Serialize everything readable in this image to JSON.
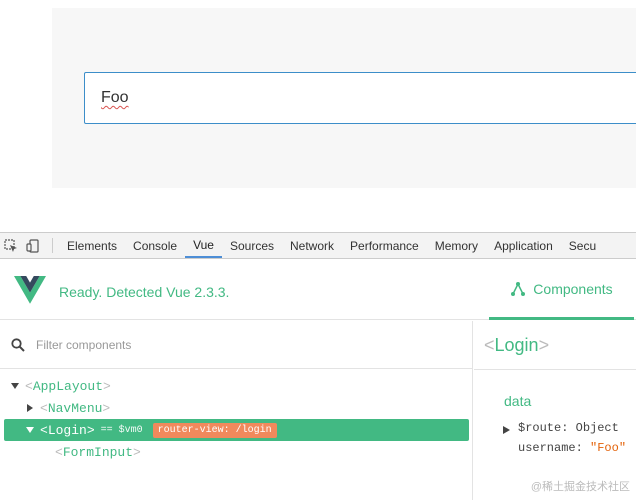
{
  "page": {
    "input_value": "Foo"
  },
  "devtools": {
    "tabs": [
      {
        "label": "Elements"
      },
      {
        "label": "Console"
      },
      {
        "label": "Vue"
      },
      {
        "label": "Sources"
      },
      {
        "label": "Network"
      },
      {
        "label": "Performance"
      },
      {
        "label": "Memory"
      },
      {
        "label": "Application"
      },
      {
        "label": "Secu"
      }
    ],
    "active_tab": "Vue"
  },
  "vue": {
    "ready_message": "Ready. Detected Vue 2.3.3.",
    "components_tab_label": "Components",
    "filter_placeholder": "Filter components",
    "tree": [
      {
        "open": "<",
        "name": "AppLayout",
        "close": ">"
      },
      {
        "open": "<",
        "name": "NavMenu",
        "close": ">"
      },
      {
        "open": "<",
        "name": "Login",
        "close": ">",
        "vm_ref": "== $vm0",
        "badge": "router-view: /login"
      },
      {
        "open": "<",
        "name": "FormInput",
        "close": ">"
      }
    ],
    "inspector": {
      "open": "<",
      "component": "Login",
      "close": ">",
      "section": "data",
      "props": [
        {
          "key": "$route",
          "sep": ": ",
          "value": "Object"
        },
        {
          "key": "username",
          "sep": ": ",
          "value": "\"Foo\""
        }
      ]
    }
  },
  "watermark": "@稀土掘金技术社区",
  "colors": {
    "vue_green": "#42b983",
    "badge_orange": "#f1895c",
    "input_border": "#3c8ec9",
    "active_tab_underline": "#4d8ed6"
  }
}
